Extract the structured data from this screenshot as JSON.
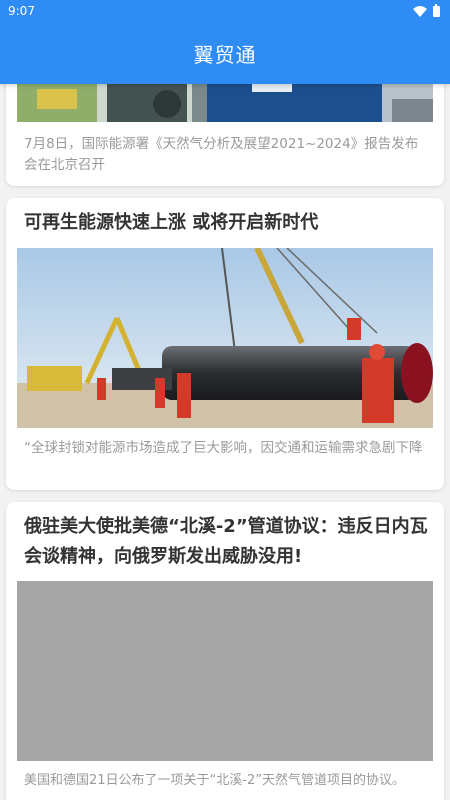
{
  "status_bar": {
    "time": "9:07"
  },
  "app_bar": {
    "title": "翼贸通"
  },
  "colors": {
    "primary": "#2f8cf5",
    "summary_text": "#9a9a9a",
    "title_text": "#333333"
  },
  "articles": [
    {
      "title": "",
      "summary": "7月8日，国际能源署《天然气分析及展望2021~2024》报告发布会在北京召开",
      "image": "industrial-workers-photo"
    },
    {
      "title": "可再生能源快速上涨 或将开启新时代",
      "summary": "“全球封锁对能源市场造成了巨大影响，因交通和运输需求急剧下降",
      "image": "pipeline-construction-photo"
    },
    {
      "title": "俄驻美大使批美德“北溪-2”管道协议：违反日内瓦会谈精神，向俄罗斯发出威胁没用!",
      "summary": "美国和德国21日公布了一项关于“北溪-2”天然气管道项目的协议。",
      "image": "image-placeholder"
    }
  ]
}
